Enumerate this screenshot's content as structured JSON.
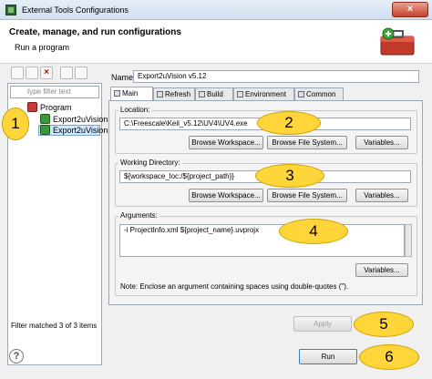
{
  "window": {
    "title": "External Tools Configurations",
    "close_glyph": "×"
  },
  "header": {
    "title": "Create, manage, and run configurations",
    "subtitle": "Run a program"
  },
  "left": {
    "filter_placeholder": "type filter text",
    "tree": {
      "root": "Program",
      "items": [
        "Export2uVision",
        "Export2uVision"
      ]
    },
    "status": "Filter matched 3 of 3 items"
  },
  "form": {
    "name_label": "Name:",
    "name_value": "Export2uVision v5.12",
    "tabs": [
      "Main",
      "Refresh",
      "Build",
      "Environment",
      "Common"
    ],
    "location": {
      "label": "Location:",
      "value": "C:\\Freescale\\Keil_v5.12\\UV4\\UV4.exe"
    },
    "working_dir": {
      "label": "Working Directory:",
      "value": "${workspace_loc:/${project_path}}"
    },
    "arguments": {
      "label": "Arguments:",
      "value": "-i ProjectInfo.xml ${project_name}.uvprojx"
    },
    "buttons": {
      "browse_workspace": "Browse Workspace...",
      "browse_file_system": "Browse File System...",
      "variables": "Variables..."
    },
    "note": "Note: Enclose an argument containing spaces using double-quotes (\")."
  },
  "footer": {
    "apply": "Apply",
    "run": "Run",
    "help_glyph": "?"
  },
  "callouts": [
    "1",
    "2",
    "3",
    "4",
    "5",
    "6"
  ],
  "colors": {
    "callout": "#ffd53a",
    "selection": "#cde8ff",
    "title_close": "#c6432c"
  },
  "icons": [
    "app-icon",
    "toolbox-icon",
    "new-config-icon",
    "duplicate-icon",
    "delete-icon",
    "collapse-icon",
    "filter-icon",
    "help-icon"
  ]
}
